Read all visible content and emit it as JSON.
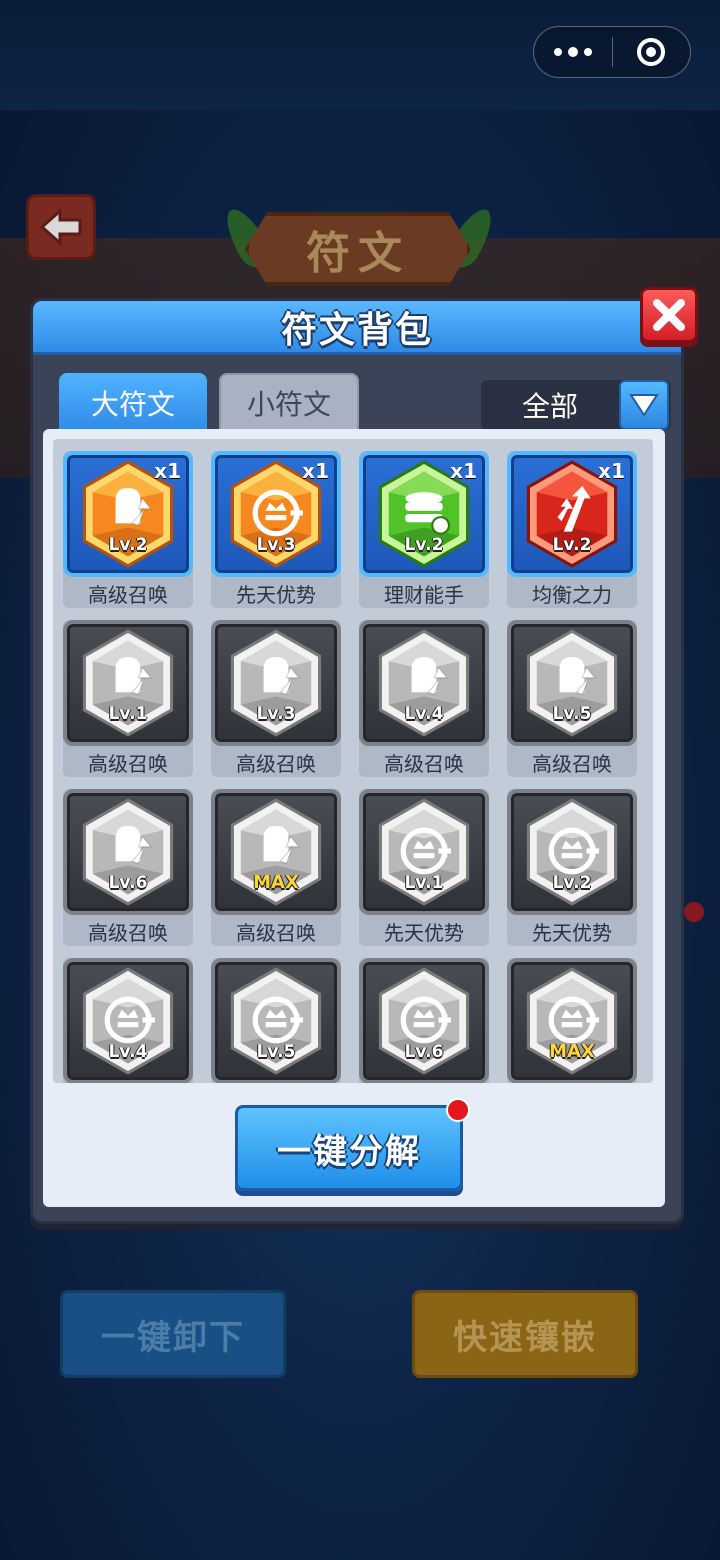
{
  "background": {
    "page_title": "符文",
    "unequip_all_label": "一键卸下",
    "quick_inlay_label": "快速镶嵌"
  },
  "modal": {
    "title": "符文背包",
    "tabs": [
      {
        "label": "大符文",
        "active": true
      },
      {
        "label": "小符文",
        "active": false
      }
    ],
    "filter": {
      "selected": "全部"
    },
    "runes": [
      {
        "name": "高级召唤",
        "level": "Lv.2",
        "count": "x1",
        "owned": true,
        "icon": "mitten-arrow-icon",
        "color": "orange"
      },
      {
        "name": "先天优势",
        "level": "Lv.3",
        "count": "x1",
        "owned": true,
        "icon": "crown-plus-icon",
        "color": "orange"
      },
      {
        "name": "理财能手",
        "level": "Lv.2",
        "count": "x1",
        "owned": true,
        "icon": "coin-stack-icon",
        "color": "green"
      },
      {
        "name": "均衡之力",
        "level": "Lv.2",
        "count": "x1",
        "owned": true,
        "icon": "split-arrows-icon",
        "color": "red"
      },
      {
        "name": "高级召唤",
        "level": "Lv.1",
        "owned": false,
        "icon": "mitten-arrow-icon"
      },
      {
        "name": "高级召唤",
        "level": "Lv.3",
        "owned": false,
        "icon": "mitten-arrow-icon"
      },
      {
        "name": "高级召唤",
        "level": "Lv.4",
        "owned": false,
        "icon": "mitten-arrow-icon"
      },
      {
        "name": "高级召唤",
        "level": "Lv.5",
        "owned": false,
        "icon": "mitten-arrow-icon"
      },
      {
        "name": "高级召唤",
        "level": "Lv.6",
        "owned": false,
        "icon": "mitten-arrow-icon"
      },
      {
        "name": "高级召唤",
        "level": "MAX",
        "owned": false,
        "icon": "mitten-arrow-icon"
      },
      {
        "name": "先天优势",
        "level": "Lv.1",
        "owned": false,
        "icon": "crown-plus-icon"
      },
      {
        "name": "先天优势",
        "level": "Lv.2",
        "owned": false,
        "icon": "crown-plus-icon"
      },
      {
        "name": "",
        "level": "Lv.4",
        "owned": false,
        "icon": "crown-plus-icon"
      },
      {
        "name": "",
        "level": "Lv.5",
        "owned": false,
        "icon": "crown-plus-icon"
      },
      {
        "name": "",
        "level": "Lv.6",
        "owned": false,
        "icon": "crown-plus-icon"
      },
      {
        "name": "",
        "level": "MAX",
        "owned": false,
        "icon": "crown-plus-icon"
      }
    ],
    "decompose_label": "一键分解"
  },
  "colors": {
    "accent_blue": "#2e8ae6",
    "close_red": "#d11f26",
    "max_gold": "#ffd43a",
    "gem_orange": "#f5841f",
    "gem_green": "#52c22a",
    "gem_red": "#d9261c",
    "gem_gray": "#bfbfbf"
  }
}
